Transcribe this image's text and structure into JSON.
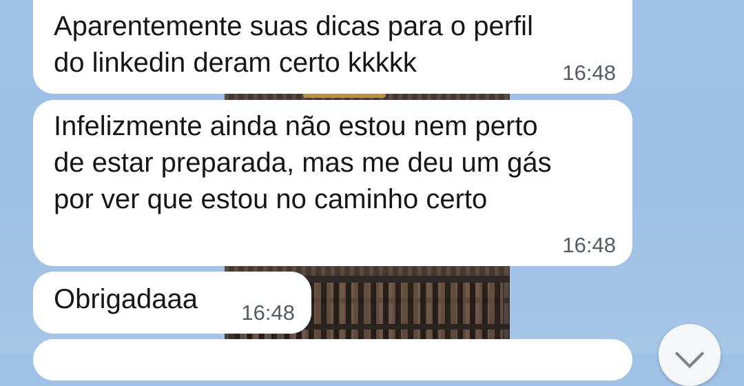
{
  "messages": [
    {
      "text": "Aparentemente suas dicas para o perfil\ndo linkedin deram certo kkkkk",
      "time": "16:48"
    },
    {
      "text": "Infelizmente ainda não estou nem perto\nde estar preparada, mas me deu um gás\npor ver que estou no caminho certo",
      "time": "16:48"
    },
    {
      "text": "Obrigadaaa",
      "time": "16:48"
    }
  ],
  "scroll_button": {
    "icon": "chevron-down-icon"
  },
  "colors": {
    "wallpaper": "#9fc1e6",
    "bubble": "#ffffff",
    "text": "#161616",
    "time": "#555b62"
  }
}
